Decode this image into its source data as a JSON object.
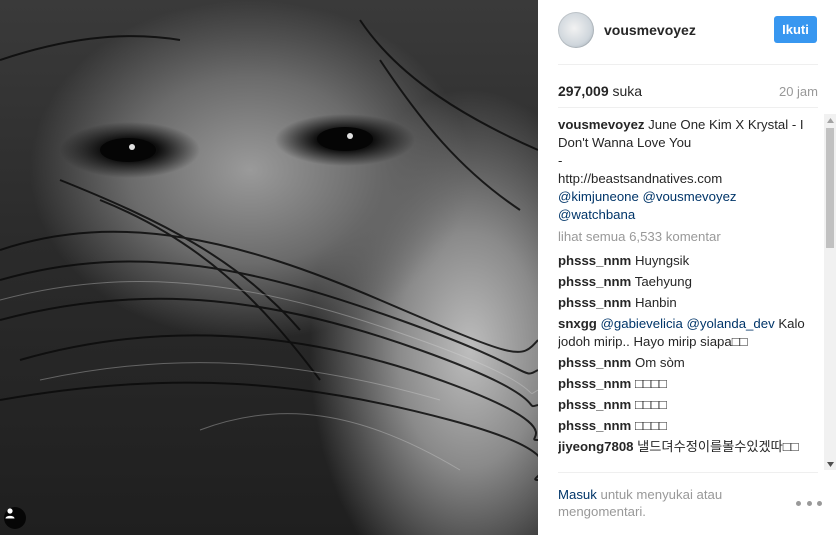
{
  "header": {
    "username": "vousmevoyez",
    "follow_label": "Ikuti"
  },
  "stats": {
    "likes_count": "297,009",
    "likes_word": "suka",
    "time_ago": "20 jam"
  },
  "caption": {
    "user": "vousmevoyez",
    "text_line": "June One Kim X Krystal - I Don't Wanna Love You",
    "dash": "-",
    "url": "http://beastsandnatives.com",
    "mentions_1": "@kimjuneone @vousmevoyez",
    "mentions_2": "@watchbana"
  },
  "view_all": "lihat semua 6,533 komentar",
  "comments": [
    {
      "user": "phsss_nnm",
      "text": "Huyngsik"
    },
    {
      "user": "phsss_nnm",
      "text": "Taehyung"
    },
    {
      "user": "phsss_nnm",
      "text": "Hanbin"
    },
    {
      "user": "snxgg",
      "mention": "@gabievelicia @yolanda_dev",
      "text": " Kalo jodoh mirip.. Hayo mirip siapa□□"
    },
    {
      "user": "phsss_nnm",
      "text": "Om sòm"
    },
    {
      "user": "phsss_nnm",
      "text": "□□□□"
    },
    {
      "user": "phsss_nnm",
      "text": "□□□□"
    },
    {
      "user": "phsss_nnm",
      "text": "□□□□"
    },
    {
      "user": "jiyeong7808",
      "text": "낼드뎌수정이를볼수있겠따□□"
    }
  ],
  "footer": {
    "login_link": "Masuk",
    "login_text": " untuk menyukai atau mengomentari."
  },
  "icons": {
    "user_tag": "user-icon",
    "more_options": "more-options-icon"
  },
  "colors": {
    "accent": "#3897f0",
    "link": "#003569",
    "muted": "#999999"
  }
}
